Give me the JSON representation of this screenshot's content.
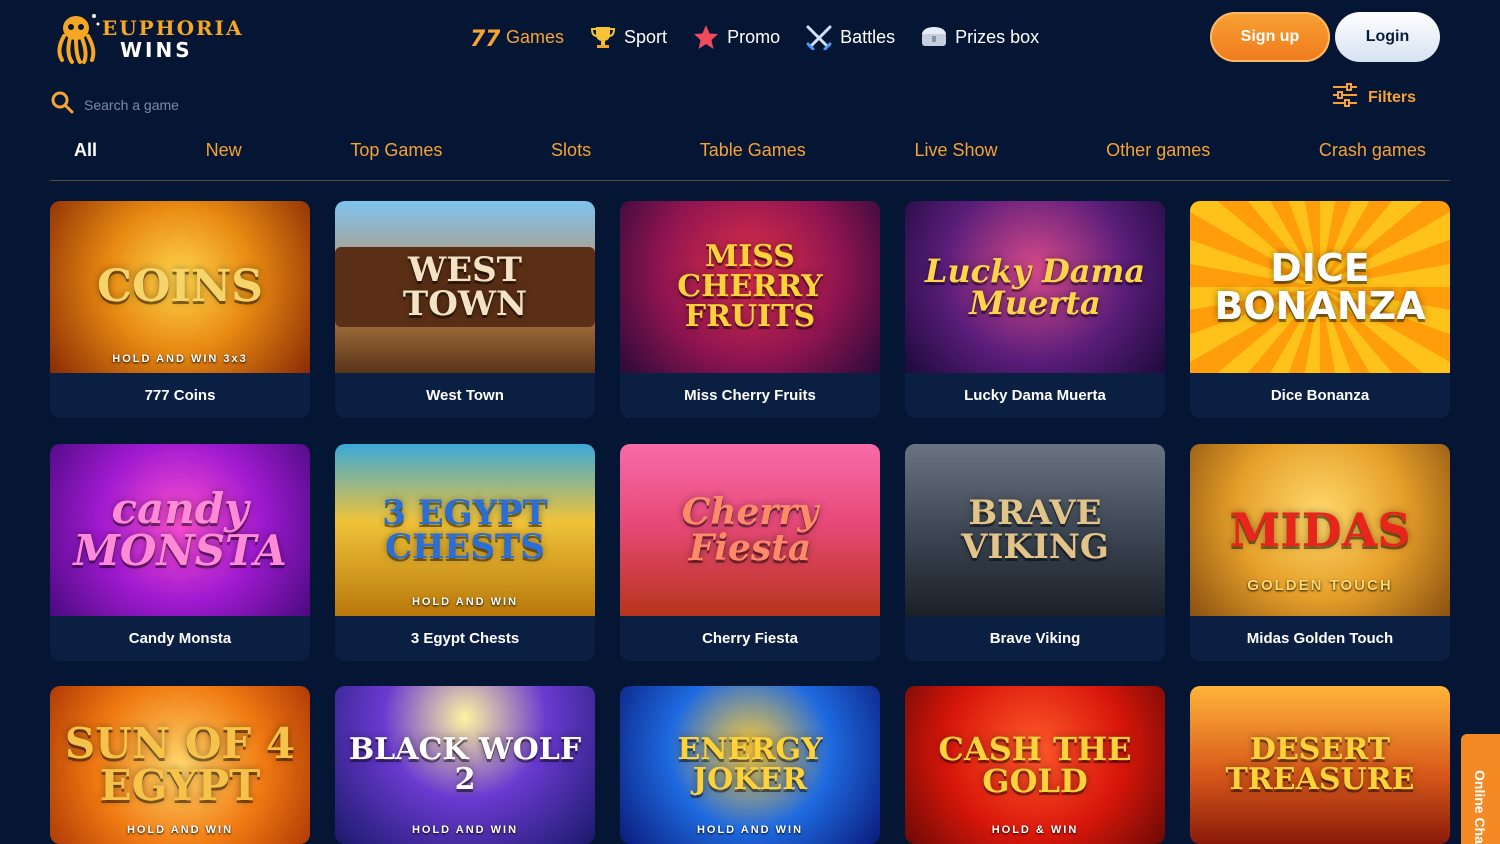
{
  "header": {
    "logo": {
      "line1": "EUPHORIA",
      "line2": "WINS"
    },
    "nav": [
      {
        "label": "Games",
        "icon": "slot-777-icon",
        "active": true
      },
      {
        "label": "Sport",
        "icon": "trophy-icon",
        "active": false
      },
      {
        "label": "Promo",
        "icon": "star-icon",
        "active": false
      },
      {
        "label": "Battles",
        "icon": "crossed-swords-icon",
        "active": false
      },
      {
        "label": "Prizes box",
        "icon": "treasure-chest-icon",
        "active": false
      }
    ],
    "signup_label": "Sign up",
    "login_label": "Login"
  },
  "search": {
    "placeholder": "Search a game",
    "value": ""
  },
  "filters_label": "Filters",
  "tabs": [
    "All",
    "New",
    "Top Games",
    "Slots",
    "Table Games",
    "Live Show",
    "Other games",
    "Crash games"
  ],
  "active_tab": "All",
  "games": [
    {
      "title": "777 Coins",
      "art": "COINS",
      "art_sub": "HOLD AND WIN 3x3"
    },
    {
      "title": "West Town",
      "art": "WEST TOWN",
      "art_sub": ""
    },
    {
      "title": "Miss Cherry Fruits",
      "art": "MISS CHERRY FRUITS",
      "art_sub": ""
    },
    {
      "title": "Lucky Dama Muerta",
      "art": "Lucky Dama Muerta",
      "art_sub": ""
    },
    {
      "title": "Dice Bonanza",
      "art": "DICE BONANZA",
      "art_sub": ""
    },
    {
      "title": "Candy Monsta",
      "art": "candy MONSTA",
      "art_sub": ""
    },
    {
      "title": "3 Egypt Chests",
      "art": "3 EGYPT CHESTS",
      "art_sub": "HOLD AND WIN"
    },
    {
      "title": "Cherry Fiesta",
      "art": "Cherry Fiesta",
      "art_sub": ""
    },
    {
      "title": "Brave Viking",
      "art": "BRAVE VIKING",
      "art_sub": ""
    },
    {
      "title": "Midas Golden Touch",
      "art": "MIDAS",
      "art_sub": "GOLDEN TOUCH"
    },
    {
      "title": "",
      "art": "SUN OF 4 EGYPT",
      "art_sub": "HOLD AND WIN"
    },
    {
      "title": "",
      "art": "BLACK WOLF 2",
      "art_sub": "HOLD AND WIN"
    },
    {
      "title": "",
      "art": "ENERGY JOKER",
      "art_sub": "HOLD AND WIN"
    },
    {
      "title": "",
      "art": "CASH THE GOLD",
      "art_sub": "HOLD & WIN"
    },
    {
      "title": "",
      "art": "DESERT TREASURE",
      "art_sub": ""
    }
  ],
  "colors": {
    "background": "#041634",
    "accent": "#f7a233",
    "card": "#0b1f42"
  },
  "chat_label": "Online Chat"
}
